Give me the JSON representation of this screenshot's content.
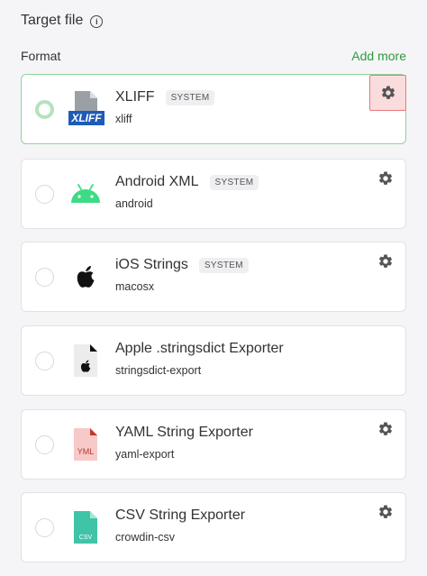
{
  "header": {
    "title": "Target file",
    "info_icon": "info-icon"
  },
  "format_label": "Format",
  "add_more": "Add more",
  "colors": {
    "accent": "#2e9a3e",
    "selected_border": "#8fd49a",
    "highlight": "#e47b7b"
  },
  "formats": [
    {
      "title": "XLIFF",
      "badge": "SYSTEM",
      "sub": "xliff",
      "icon": "xliff-file-icon",
      "selected": true,
      "gear": true,
      "gear_highlighted": true
    },
    {
      "title": "Android XML",
      "badge": "SYSTEM",
      "sub": "android",
      "icon": "android-icon",
      "selected": false,
      "gear": true
    },
    {
      "title": "iOS Strings",
      "badge": "SYSTEM",
      "sub": "macosx",
      "icon": "apple-icon",
      "selected": false,
      "gear": true
    },
    {
      "title": "Apple .stringsdict Exporter",
      "sub": "stringsdict-export",
      "icon": "apple-file-icon",
      "selected": false,
      "gear": false
    },
    {
      "title": "YAML String Exporter",
      "sub": "yaml-export",
      "icon": "yaml-file-icon",
      "icon_text": "YML",
      "selected": false,
      "gear": true
    },
    {
      "title": "CSV String Exporter",
      "sub": "crowdin-csv",
      "icon": "csv-file-icon",
      "icon_text": "CSV",
      "selected": false,
      "gear": true
    }
  ]
}
